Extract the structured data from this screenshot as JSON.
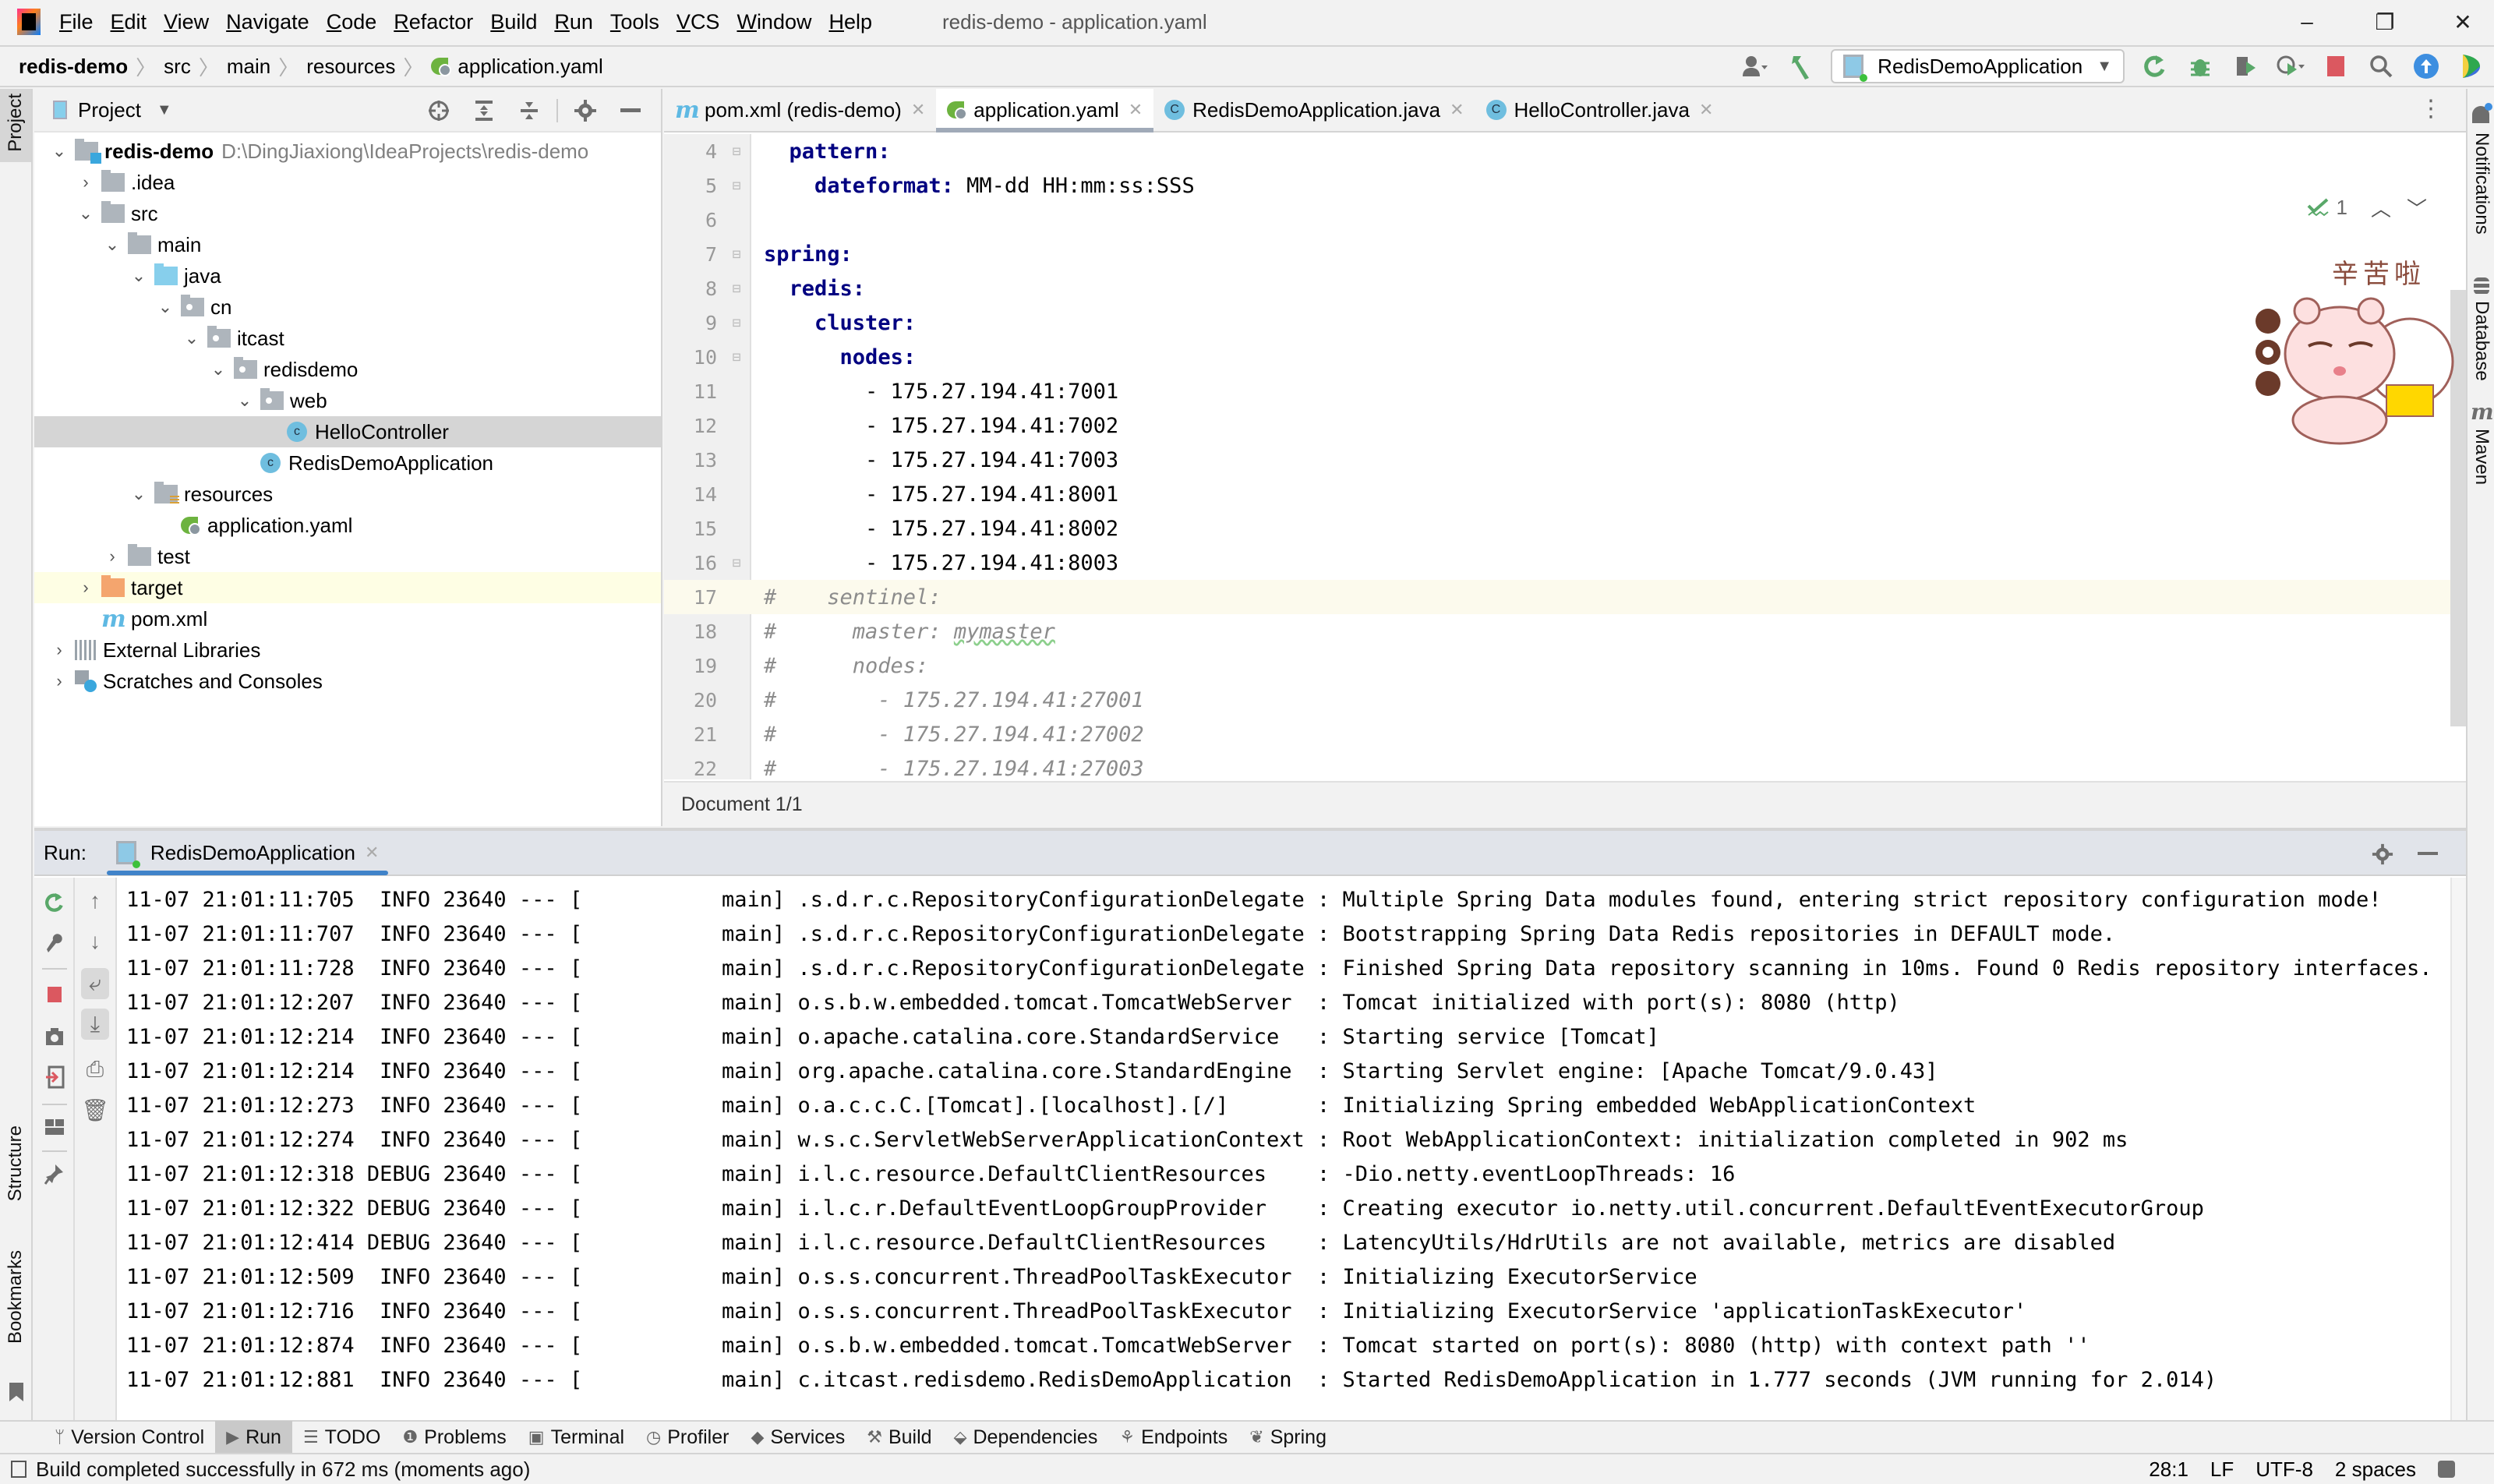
{
  "window": {
    "title": "redis-demo - application.yaml",
    "controls": {
      "minimize": "–",
      "restore": "❐",
      "close": "✕"
    }
  },
  "menu": [
    "File",
    "Edit",
    "View",
    "Navigate",
    "Code",
    "Refactor",
    "Build",
    "Run",
    "Tools",
    "VCS",
    "Window",
    "Help"
  ],
  "breadcrumb": [
    "redis-demo",
    "src",
    "main",
    "resources",
    "application.yaml"
  ],
  "toolbar": {
    "run_config": "RedisDemoApplication",
    "icons": [
      "user-icon",
      "build-hammer-icon",
      "rerun-icon",
      "debug-icon",
      "coverage-icon",
      "profile-icon",
      "stop-icon",
      "search-icon",
      "update-icon",
      "jetbrains-ai-icon"
    ],
    "colors": {
      "run_green": "#59a869",
      "stop_red": "#db5860",
      "update_blue": "#3d8ee0"
    }
  },
  "left_strip": {
    "project": "Project",
    "structure": "Structure",
    "bookmarks": "Bookmarks"
  },
  "right_strip": {
    "notifications": "Notifications",
    "database": "Database",
    "maven": "Maven"
  },
  "project_panel": {
    "title": "Project",
    "tree": [
      {
        "label": "redis-demo",
        "detail": "D:\\DingJiaxiong\\IdeaProjects\\redis-demo",
        "depth": 0,
        "expanded": true,
        "icon": "module-folder"
      },
      {
        "label": ".idea",
        "depth": 1,
        "expanded": false,
        "icon": "folder"
      },
      {
        "label": "src",
        "depth": 1,
        "expanded": true,
        "icon": "folder"
      },
      {
        "label": "main",
        "depth": 2,
        "expanded": true,
        "icon": "folder"
      },
      {
        "label": "java",
        "depth": 3,
        "expanded": true,
        "icon": "source-folder"
      },
      {
        "label": "cn",
        "depth": 4,
        "expanded": true,
        "icon": "package"
      },
      {
        "label": "itcast",
        "depth": 5,
        "expanded": true,
        "icon": "package"
      },
      {
        "label": "redisdemo",
        "depth": 6,
        "expanded": true,
        "icon": "package"
      },
      {
        "label": "web",
        "depth": 7,
        "expanded": true,
        "icon": "package"
      },
      {
        "label": "HelloController",
        "depth": 8,
        "icon": "class",
        "selected": true
      },
      {
        "label": "RedisDemoApplication",
        "depth": 7,
        "icon": "spring-boot-class"
      },
      {
        "label": "resources",
        "depth": 3,
        "expanded": true,
        "icon": "resources-folder"
      },
      {
        "label": "application.yaml",
        "depth": 4,
        "icon": "spring-yaml"
      },
      {
        "label": "test",
        "depth": 2,
        "expanded": false,
        "icon": "folder"
      },
      {
        "label": "target",
        "depth": 1,
        "expanded": false,
        "icon": "excluded-folder",
        "highlighted": true
      },
      {
        "label": "pom.xml",
        "depth": 1,
        "icon": "maven"
      },
      {
        "label": "External Libraries",
        "depth": 0,
        "expanded": false,
        "icon": "libraries"
      },
      {
        "label": "Scratches and Consoles",
        "depth": 0,
        "expanded": false,
        "icon": "scratches"
      }
    ]
  },
  "editor": {
    "tabs": [
      {
        "label": "pom.xml (redis-demo)",
        "icon": "maven",
        "active": false
      },
      {
        "label": "application.yaml",
        "icon": "spring-yaml",
        "active": true
      },
      {
        "label": "RedisDemoApplication.java",
        "icon": "spring-boot-class",
        "active": false
      },
      {
        "label": "HelloController.java",
        "icon": "class",
        "active": false
      }
    ],
    "inspection": {
      "count": "1"
    },
    "lines": [
      {
        "n": "4",
        "indent": "  ",
        "key": "pattern:",
        "value": ""
      },
      {
        "n": "5",
        "indent": "    ",
        "key": "dateformat:",
        "value": " MM-dd HH:mm:ss:SSS"
      },
      {
        "n": "6",
        "indent": "",
        "key": "",
        "value": ""
      },
      {
        "n": "7",
        "indent": "",
        "key": "spring:",
        "value": ""
      },
      {
        "n": "8",
        "indent": "  ",
        "key": "redis:",
        "value": ""
      },
      {
        "n": "9",
        "indent": "    ",
        "key": "cluster:",
        "value": ""
      },
      {
        "n": "10",
        "indent": "      ",
        "key": "nodes:",
        "value": ""
      },
      {
        "n": "11",
        "indent": "        ",
        "key": "",
        "value": "- 175.27.194.41:7001"
      },
      {
        "n": "12",
        "indent": "        ",
        "key": "",
        "value": "- 175.27.194.41:7002"
      },
      {
        "n": "13",
        "indent": "        ",
        "key": "",
        "value": "- 175.27.194.41:7003"
      },
      {
        "n": "14",
        "indent": "        ",
        "key": "",
        "value": "- 175.27.194.41:8001"
      },
      {
        "n": "15",
        "indent": "        ",
        "key": "",
        "value": "- 175.27.194.41:8002"
      },
      {
        "n": "16",
        "indent": "        ",
        "key": "",
        "value": "- 175.27.194.41:8003"
      },
      {
        "n": "17",
        "comment": "#    sentinel:",
        "caret": true
      },
      {
        "n": "18",
        "comment": "#      master: ",
        "squiggle": "mymaster"
      },
      {
        "n": "19",
        "comment": "#      nodes:"
      },
      {
        "n": "20",
        "comment": "#        - 175.27.194.41:27001"
      },
      {
        "n": "21",
        "comment": "#        - 175.27.194.41:27002"
      },
      {
        "n": "22",
        "comment": "#        - 175.27.194.41:27003"
      }
    ],
    "doc_breadcrumb": "Document 1/1",
    "sticker_text": "辛苦啦"
  },
  "run_panel": {
    "label": "Run:",
    "tab": "RedisDemoApplication",
    "log": [
      "11-07 21:01:11:705  INFO 23640 --- [           main] .s.d.r.c.RepositoryConfigurationDelegate : Multiple Spring Data modules found, entering strict repository configuration mode!",
      "11-07 21:01:11:707  INFO 23640 --- [           main] .s.d.r.c.RepositoryConfigurationDelegate : Bootstrapping Spring Data Redis repositories in DEFAULT mode.",
      "11-07 21:01:11:728  INFO 23640 --- [           main] .s.d.r.c.RepositoryConfigurationDelegate : Finished Spring Data repository scanning in 10ms. Found 0 Redis repository interfaces.",
      "11-07 21:01:12:207  INFO 23640 --- [           main] o.s.b.w.embedded.tomcat.TomcatWebServer  : Tomcat initialized with port(s): 8080 (http)",
      "11-07 21:01:12:214  INFO 23640 --- [           main] o.apache.catalina.core.StandardService   : Starting service [Tomcat]",
      "11-07 21:01:12:214  INFO 23640 --- [           main] org.apache.catalina.core.StandardEngine  : Starting Servlet engine: [Apache Tomcat/9.0.43]",
      "11-07 21:01:12:273  INFO 23640 --- [           main] o.a.c.c.C.[Tomcat].[localhost].[/]       : Initializing Spring embedded WebApplicationContext",
      "11-07 21:01:12:274  INFO 23640 --- [           main] w.s.c.ServletWebServerApplicationContext : Root WebApplicationContext: initialization completed in 902 ms",
      "11-07 21:01:12:318 DEBUG 23640 --- [           main] i.l.c.resource.DefaultClientResources    : -Dio.netty.eventLoopThreads: 16",
      "11-07 21:01:12:322 DEBUG 23640 --- [           main] i.l.c.r.DefaultEventLoopGroupProvider    : Creating executor io.netty.util.concurrent.DefaultEventExecutorGroup",
      "11-07 21:01:12:414 DEBUG 23640 --- [           main] i.l.c.resource.DefaultClientResources    : LatencyUtils/HdrUtils are not available, metrics are disabled",
      "11-07 21:01:12:509  INFO 23640 --- [           main] o.s.s.concurrent.ThreadPoolTaskExecutor  : Initializing ExecutorService",
      "11-07 21:01:12:716  INFO 23640 --- [           main] o.s.s.concurrent.ThreadPoolTaskExecutor  : Initializing ExecutorService 'applicationTaskExecutor'",
      "11-07 21:01:12:874  INFO 23640 --- [           main] o.s.b.w.embedded.tomcat.TomcatWebServer  : Tomcat started on port(s): 8080 (http) with context path ''",
      "11-07 21:01:12:881  INFO 23640 --- [           main] c.itcast.redisdemo.RedisDemoApplication  : Started RedisDemoApplication in 1.777 seconds (JVM running for 2.014)"
    ]
  },
  "bottom_tools": [
    {
      "label": "Version Control",
      "icon": "ᛘ"
    },
    {
      "label": "Run",
      "icon": "▶",
      "active": true
    },
    {
      "label": "TODO",
      "icon": "☰"
    },
    {
      "label": "Problems",
      "icon": "❶"
    },
    {
      "label": "Terminal",
      "icon": "▣"
    },
    {
      "label": "Profiler",
      "icon": "◷"
    },
    {
      "label": "Services",
      "icon": "◆"
    },
    {
      "label": "Build",
      "icon": "⚒"
    },
    {
      "label": "Dependencies",
      "icon": "⬙"
    },
    {
      "label": "Endpoints",
      "icon": "⚘"
    },
    {
      "label": "Spring",
      "icon": "❦"
    }
  ],
  "status": {
    "message": "Build completed successfully in 672 ms (moments ago)",
    "position": "28:1",
    "line_sep": "LF",
    "encoding": "UTF-8",
    "indent": "2 spaces"
  }
}
